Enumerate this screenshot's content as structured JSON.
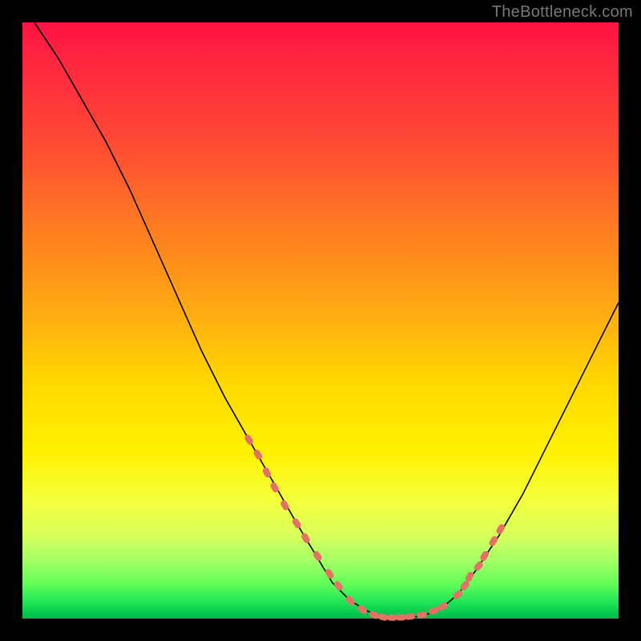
{
  "watermark": "TheBottleneck.com",
  "colors": {
    "frame": "#000000",
    "curve": "#000000",
    "dots": "#e27265",
    "gradient_top": "#ff1443",
    "gradient_bottom": "#00b845"
  },
  "chart_data": {
    "type": "line",
    "title": "",
    "xlabel": "",
    "ylabel": "",
    "xlim": [
      0,
      100
    ],
    "ylim": [
      0,
      100
    ],
    "annotations": [
      "TheBottleneck.com"
    ],
    "legend": false,
    "grid": false,
    "series": [
      {
        "name": "bottleneck-curve",
        "x": [
          2,
          6,
          10,
          14,
          18,
          22,
          26,
          30,
          34,
          38,
          42,
          46,
          49,
          52,
          55,
          58,
          61,
          64,
          67,
          70,
          73,
          76,
          80,
          84,
          88,
          92,
          96,
          100
        ],
        "y": [
          100,
          94,
          87,
          80,
          72,
          63,
          54,
          45,
          37,
          30,
          23,
          16,
          11,
          6,
          3,
          1.2,
          0.3,
          0.15,
          0.4,
          1.5,
          4,
          8,
          14,
          21,
          29,
          37,
          45,
          53
        ]
      }
    ],
    "highlight_points": {
      "comment": "salmon dashed/dotted markers along the lower portion of the V curve",
      "x": [
        38,
        39.5,
        41,
        42.3,
        44,
        46,
        47.5,
        49.5,
        51.5,
        53,
        55,
        57,
        59,
        60.5,
        62,
        63.5,
        65,
        67,
        69,
        70.5,
        73,
        74.2,
        75,
        76.5,
        77.5,
        79,
        80.2
      ],
      "y": [
        30,
        27.5,
        24.5,
        22,
        19,
        16,
        13.5,
        10.5,
        7.5,
        5.5,
        3,
        1.5,
        0.6,
        0.25,
        0.18,
        0.2,
        0.35,
        0.6,
        1.3,
        2.0,
        4.0,
        5.5,
        7.0,
        8.8,
        10.5,
        13.0,
        15.0
      ]
    }
  }
}
